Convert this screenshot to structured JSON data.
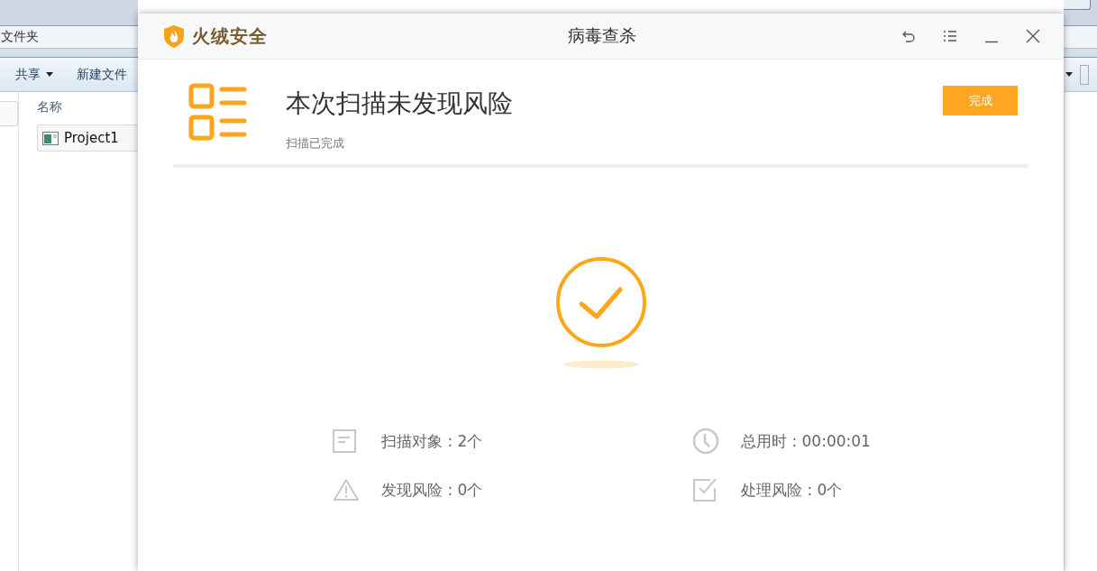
{
  "explorer": {
    "address": "文件夹",
    "toolbar": [
      {
        "label": "共享",
        "dropdown": true
      },
      {
        "label": "新建文件",
        "dropdown": false
      }
    ],
    "column_header": "名称",
    "files": [
      {
        "name": "Project1"
      }
    ]
  },
  "dialog": {
    "brand": "火绒安全",
    "title": "病毒查杀",
    "controls": [
      {
        "kind": "back"
      },
      {
        "kind": "menu"
      },
      {
        "kind": "minimize"
      },
      {
        "kind": "close"
      }
    ],
    "result": {
      "title": "本次扫描未发现风险",
      "subtitle": "扫描已完成",
      "button": "完成"
    },
    "stats": [
      {
        "kind": "objects",
        "text": "扫描对象 : 2个"
      },
      {
        "kind": "time",
        "text": "总用时 : 00:00:01"
      },
      {
        "kind": "risks",
        "text": "发现风险 : 0个"
      },
      {
        "kind": "handled",
        "text": "处理风险 : 0个"
      }
    ]
  }
}
